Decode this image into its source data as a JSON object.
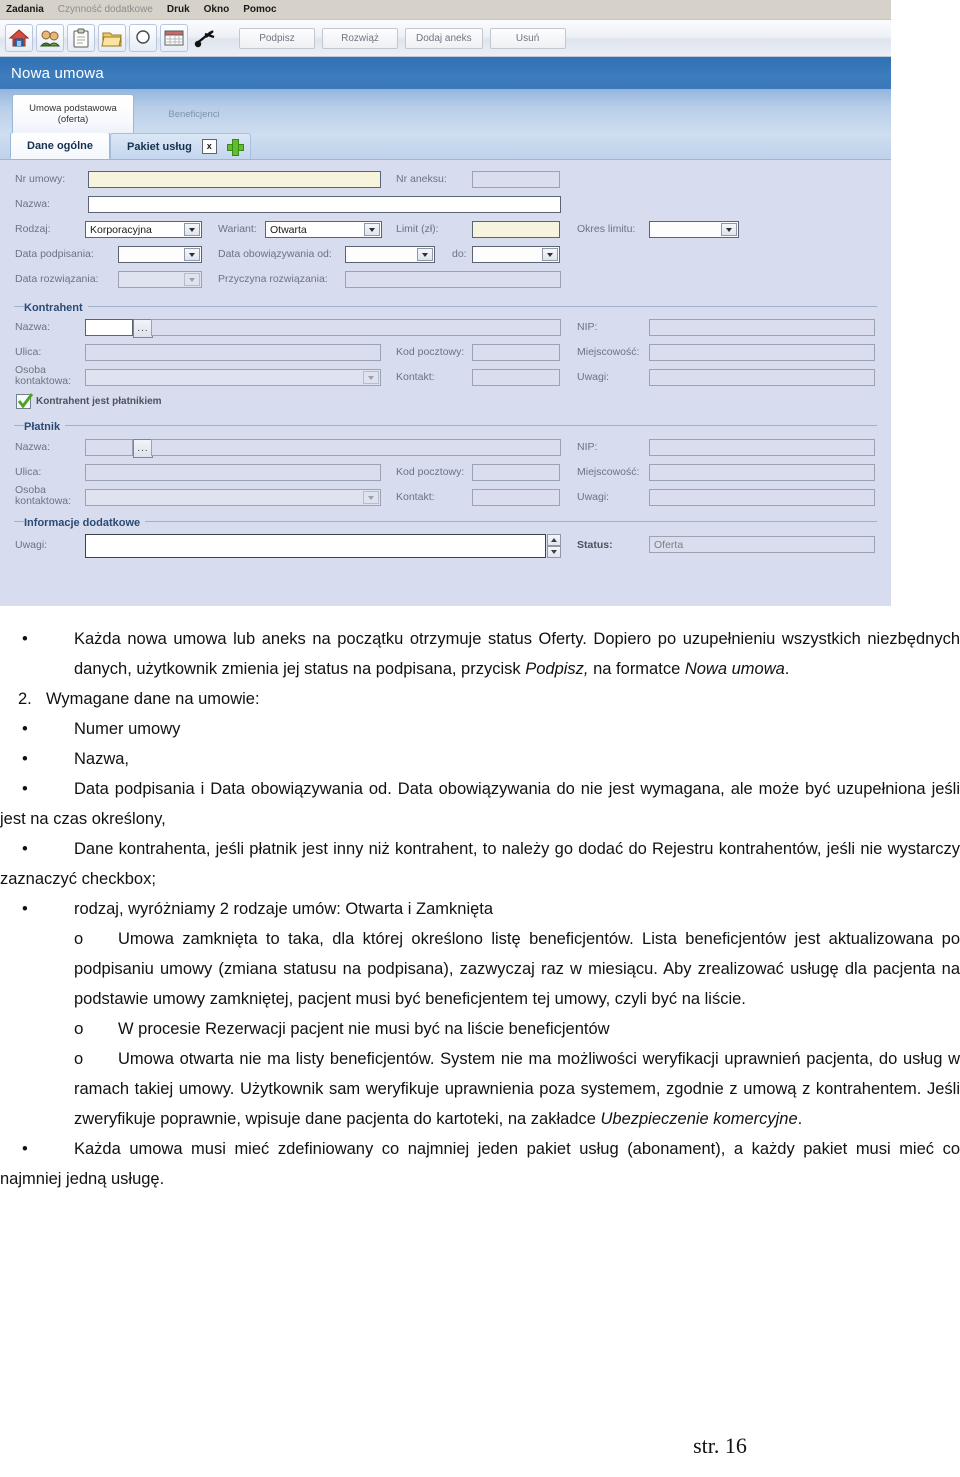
{
  "screenshot": {
    "menubar": [
      {
        "label": "Zadania",
        "dim": false,
        "bold": true
      },
      {
        "label": "Czynność dodatkowe",
        "dim": true,
        "bold": false
      },
      {
        "label": "Druk",
        "dim": false,
        "bold": true
      },
      {
        "label": "Okno",
        "dim": false,
        "bold": true
      },
      {
        "label": "Pomoc",
        "dim": false,
        "bold": true
      }
    ],
    "toolbar": {
      "icons": [
        {
          "name": "home-icon"
        },
        {
          "name": "patients-icon"
        },
        {
          "name": "clipboard-icon"
        },
        {
          "name": "folder-icon"
        },
        {
          "name": "circle-icon"
        },
        {
          "name": "calendar-icon"
        },
        {
          "name": "tools-icon"
        }
      ],
      "buttons": [
        {
          "label": "Podpisz"
        },
        {
          "label": "Rozwiąż"
        },
        {
          "label": "Dodaj aneks"
        },
        {
          "label": "Usuń"
        }
      ]
    },
    "window_title": "Nowa umowa",
    "outer_tabs": [
      {
        "line1": "Umowa podstawowa",
        "line2": "(oferta)",
        "active": true
      },
      {
        "line1": "Beneficjenci",
        "line2": "",
        "active": false
      }
    ],
    "inner_tabs": [
      {
        "label": "Dane ogólne",
        "active": true
      },
      {
        "label": "Pakiet usług",
        "active": false
      }
    ],
    "close_tab_glyph": "x",
    "add_tab_icon": "plus-icon",
    "fields": {
      "nr_umowy_label": "Nr umowy:",
      "nr_umowy_value": "",
      "nr_aneksu_label": "Nr aneksu:",
      "nr_aneksu_value": "",
      "nazwa_label": "Nazwa:",
      "nazwa_value": "",
      "rodzaj_label": "Rodzaj:",
      "rodzaj_value": "Korporacyjna",
      "wariant_label": "Wariant:",
      "wariant_value": "Otwarta",
      "limit_label": "Limit (zł):",
      "limit_value": "",
      "okres_limitu_label": "Okres limitu:",
      "okres_limitu_value": "",
      "data_podpisania_label": "Data podpisania:",
      "data_podpisania_value": "",
      "data_obow_od_label": "Data obowiązywania od:",
      "data_obow_od_value": "",
      "do_label": "do:",
      "do_value": "",
      "data_rozwiazania_label": "Data rozwiązania:",
      "data_rozwiazania_value": "",
      "przyczyna_label": "Przyczyna rozwiązania:",
      "przyczyna_value": ""
    },
    "kontrahent": {
      "group_title": "Kontrahent",
      "nazwa_label": "Nazwa:",
      "nazwa_value": "",
      "picker_glyph": "...",
      "nip_label": "NIP:",
      "nip_value": "",
      "ulica_label": "Ulica:",
      "ulica_value": "",
      "kod_label": "Kod pocztowy:",
      "kod_value": "",
      "miejscowosc_label": "Miejscowość:",
      "miejscowosc_value": "",
      "osoba_label_1": "Osoba",
      "osoba_label_2": "kontaktowa:",
      "osoba_value": "",
      "kontakt_label": "Kontakt:",
      "kontakt_value": "",
      "uwagi_label": "Uwagi:",
      "uwagi_value": "",
      "checkbox_label": "Kontrahent jest płatnikiem",
      "checkbox_checked": true
    },
    "platnik": {
      "group_title": "Płatnik",
      "nazwa_label": "Nazwa:",
      "nazwa_value": "",
      "picker_glyph": "...",
      "nip_label": "NIP:",
      "nip_value": "",
      "ulica_label": "Ulica:",
      "ulica_value": "",
      "kod_label": "Kod pocztowy:",
      "kod_value": "",
      "miejscowosc_label": "Miejscowość:",
      "miejscowosc_value": "",
      "osoba_label_1": "Osoba",
      "osoba_label_2": "kontaktowa:",
      "osoba_value": "",
      "kontakt_label": "Kontakt:",
      "kontakt_value": "",
      "uwagi_label": "Uwagi:",
      "uwagi_value": ""
    },
    "info": {
      "group_title": "Informacje dodatkowe",
      "uwagi_label": "Uwagi:",
      "uwagi_value": "",
      "status_label": "Status:",
      "status_value": "Oferta"
    },
    "colors": {
      "titlebar": "#3a78b9",
      "form_bg": "#d8dcef",
      "group_title": "#2b4a73",
      "required_field": "#f7f4dd",
      "checkbox_green": "#5fbd2e"
    }
  },
  "document": {
    "b1": "Każda nowa umowa lub aneks na początku otrzymuje status Oferty. Dopiero po uzupełnieniu wszystkich niezbędnych danych, użytkownik zmienia jej status na podpisana,  przycisk ",
    "b1_em": "Podpisz,",
    "b1_b": " na formatce ",
    "b1_em2": "Nowa umowa",
    "b1_end": ".",
    "n2": "Wymagane dane na  umowie:",
    "n2_marker": "2.",
    "i1": "Numer umowy",
    "i2": "Nazwa,",
    "i3": "Data podpisania i Data obowiązywania od. Data obowiązywania do nie jest wymagana, ale może być uzupełniona jeśli jest na czas określony,",
    "i4": "Dane kontrahenta, jeśli płatnik jest inny niż kontrahent, to należy go dodać do Rejestru kontrahentów, jeśli nie wystarczy zaznaczyć checkbox;",
    "i5": "rodzaj, wyróżniamy 2 rodzaje umów: Otwarta i Zamknięta",
    "o1": "Umowa zamknięta to taka, dla której określono listę beneficjentów. Lista beneficjentów jest aktualizowana  po podpisaniu umowy (zmiana statusu na podpisana), zazwyczaj  raz w miesiącu. Aby zrealizować usługę dla pacjenta na podstawie umowy zamkniętej, pacjent musi być beneficjentem tej umowy, czyli być na liście.",
    "o2": "W procesie Rezerwacji pacjent nie musi być na liście beneficjentów",
    "o3": "Umowa otwarta nie ma listy beneficjentów. System nie ma możliwości weryfikacji uprawnień pacjenta, do usług w ramach takiej umowy. Użytkownik sam weryfikuje uprawnienia poza systemem, zgodnie z umową z kontrahentem. Jeśli zweryfikuje poprawnie, wpisuje dane pacjenta do kartoteki, na zakładce ",
    "o3_em": "Ubezpieczenie komercyjne",
    "o3_end": ".",
    "b_last": "Każda umowa musi mieć zdefiniowany co najmniej jeden pakiet usług (abonament), a każdy pakiet  musi mieć co najmniej jedną usługę.",
    "bullet_disc": "•",
    "bullet_circle": "o",
    "page_number": "str. 16"
  }
}
